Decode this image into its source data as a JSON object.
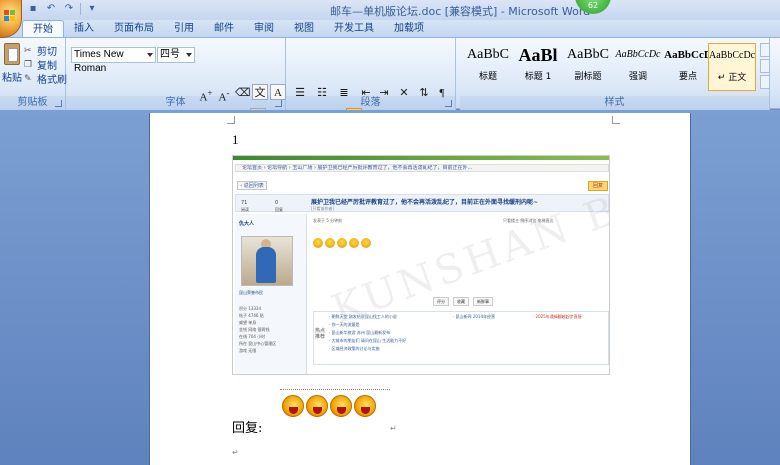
{
  "window": {
    "title": "邮车—单机版论坛.doc [兼容模式] - Microsoft Word",
    "badge": "62"
  },
  "tabs": [
    "开始",
    "插入",
    "页面布局",
    "引用",
    "邮件",
    "审阅",
    "视图",
    "开发工具",
    "加载项"
  ],
  "ribbon": {
    "clipboard": {
      "paste": "粘贴",
      "cut": "剪切",
      "copy": "复制",
      "format_painter": "格式刷",
      "label": "剪贴板"
    },
    "font": {
      "name": "Times New Roman",
      "size": "四号",
      "label": "字体"
    },
    "paragraph": {
      "label": "段落"
    },
    "styles": {
      "label": "样式",
      "items": [
        {
          "sample": "AaBbC",
          "name": "标题"
        },
        {
          "sample": "AaBl",
          "name": "标题 1"
        },
        {
          "sample": "AaBbC",
          "name": "副标题"
        },
        {
          "sample": "AaBbCcDc",
          "name": "强调"
        },
        {
          "sample": "AaBbCcD",
          "name": "要点"
        },
        {
          "sample": "AaBbCcDc",
          "name": "↵ 正文"
        }
      ]
    }
  },
  "document": {
    "page_number": "1",
    "reply_label": "回复:",
    "embedded": {
      "crumb": "论坛首页 › 论坛导航 › 玉山广场 › 展护卫我已经严厉批评教育过了，他不会再活泼乱纪了，目前正在外...",
      "back": "‹ 返回列表",
      "reply_btn": "回复",
      "views": "71",
      "views_label": "阅读",
      "replies": "0",
      "replies_label": "回复",
      "title": "展护卫我已经严厉批评教育过了，他不会再活泼乱纪了，目前正在外面寻找缓刑内呢~",
      "title_sub": "[复制链接]",
      "title_small": "[只看该作者]",
      "author": "仇大人",
      "author_meta": "只看楼主  倒序浏览  电梯直达",
      "post_meta": "发表于 5 分钟前",
      "user_title": "昆山荣誉市民",
      "info": [
        "积分 13334",
        "帖子 4746 贴",
        "威望 单身",
        "金钱 网络 银两钱",
        "在线 704 小时",
        "所在 昆山中心管理区",
        "游戏 无限"
      ],
      "actions": [
        "评分",
        "收藏",
        "新鲜事"
      ],
      "rec_label": "热点推荐",
      "rec_lines": [
        "· 朝鲜天堂 刚发帖说昆山找工人的小说",
        "· 你一天的流量是",
        "· 昆山新华旅游 苏州 昆山最新发布",
        "· 大城市的朋友们 请问在昆山 生活能力不好",
        "· 区域经济政策的讨论与实施",
        "· 昆山新闻 2014年经营",
        "· 2025年通缉翻越起步直接"
      ],
      "watermark": "KUNSHAN BBS"
    }
  }
}
